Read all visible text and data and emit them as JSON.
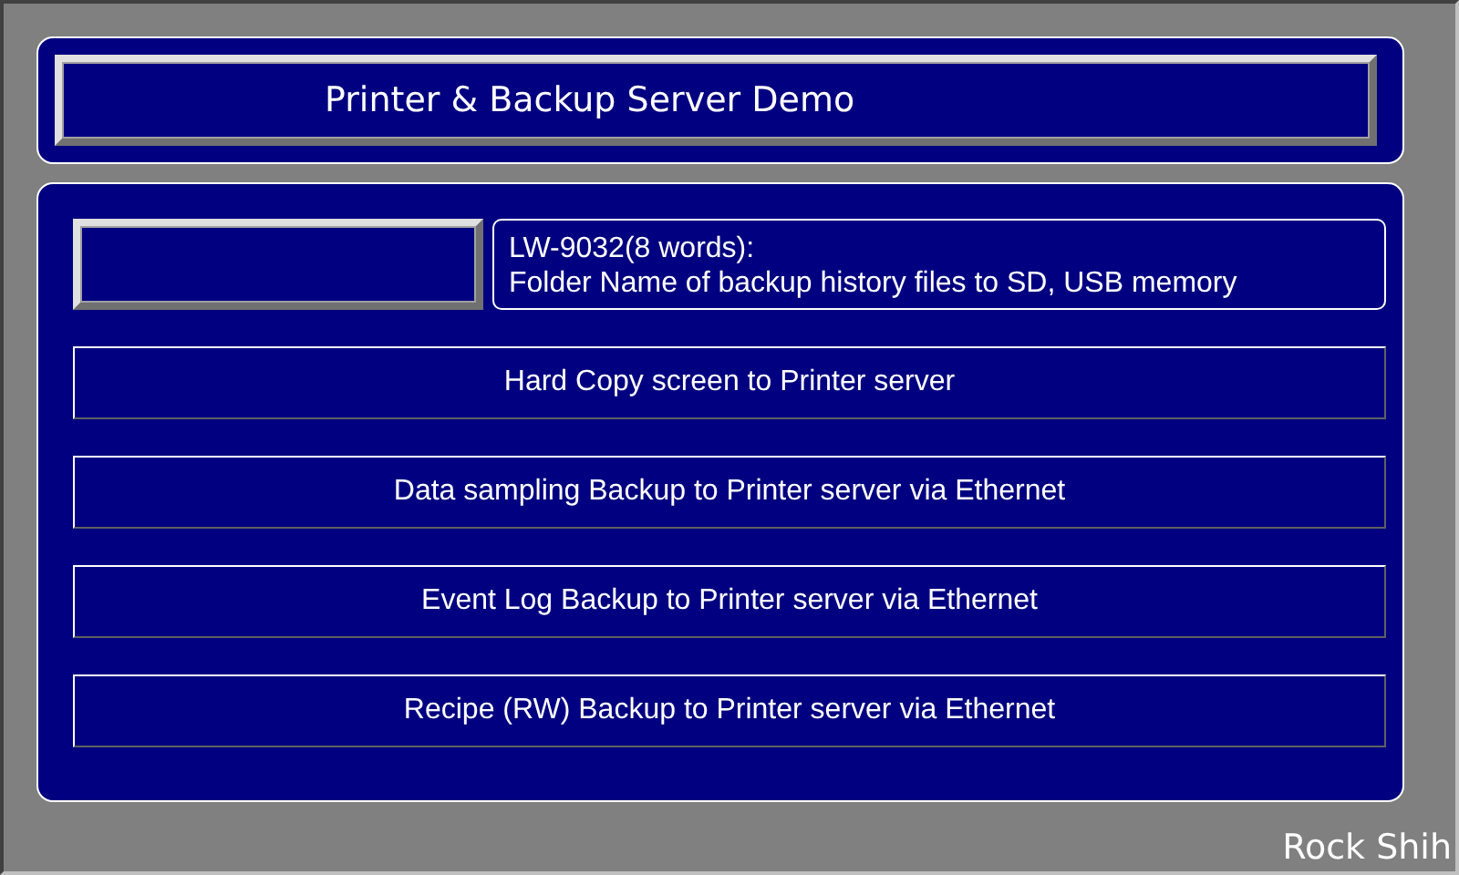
{
  "header": {
    "title": "Printer & Backup Server Demo"
  },
  "folder_setting": {
    "label_lines": [
      "LW-9032(8 words):",
      "Folder Name of backup history files to SD, USB memory"
    ]
  },
  "buttons": [
    {
      "label": "Hard Copy screen to Printer server"
    },
    {
      "label": "Data sampling Backup to Printer server via Ethernet"
    },
    {
      "label": "Event Log Backup to Printer server via Ethernet"
    },
    {
      "label": "Recipe (RW) Backup to Printer server via Ethernet"
    }
  ],
  "signature": "Rock Shih"
}
